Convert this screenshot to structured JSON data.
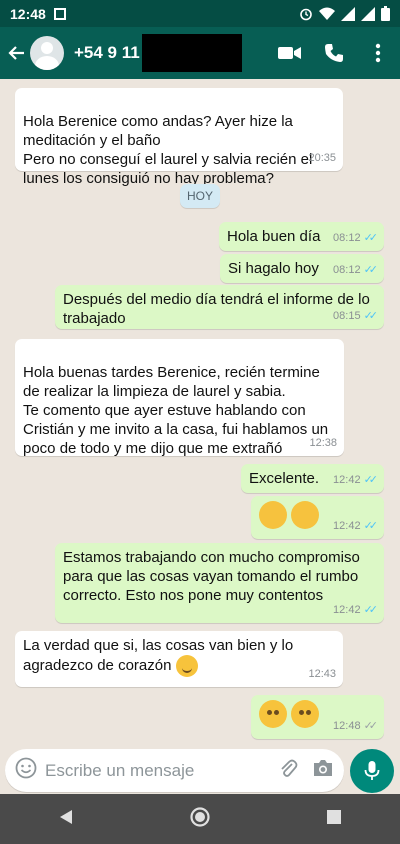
{
  "status_bar": {
    "time": "12:48"
  },
  "header": {
    "contact_name": "+54 9 11"
  },
  "date_chip": "HOY",
  "messages": [
    {
      "dir": "in",
      "text": "Hola Berenice como andas? Ayer hize la meditación y el baño\nPero no conseguí el laurel y salvia recién el lunes los consiguió no hay problema?",
      "time": "20:35"
    },
    {
      "dir": "out",
      "text": "Hola buen día",
      "time": "08:12"
    },
    {
      "dir": "out",
      "text": "Si hagalo hoy",
      "time": "08:12"
    },
    {
      "dir": "out",
      "text": "Después del medio día tendrá el informe de lo trabajado",
      "time": "08:15"
    },
    {
      "dir": "in",
      "text": "Hola buenas tardes Berenice, recién termine de realizar la limpieza de laurel y sabia.\nTe comento que ayer estuve hablando con Cristián y me invito a la casa, fui hablamos un poco de todo y me dijo que me extrañó",
      "time": "12:38"
    },
    {
      "dir": "out",
      "text": "Excelente.",
      "time": "12:42"
    },
    {
      "dir": "out",
      "text": "",
      "time": "12:42"
    },
    {
      "dir": "out",
      "text": "Estamos trabajando con mucho compromiso para que las cosas vayan tomando el rumbo correcto. Esto nos pone muy contentos",
      "time": "12:42"
    },
    {
      "dir": "in",
      "text": "La verdad que si, las cosas van bien y lo agradezco de corazón",
      "time": "12:43"
    },
    {
      "dir": "out",
      "text": "",
      "time": "12:48"
    }
  ],
  "composer": {
    "placeholder": "Escribe un mensaje"
  },
  "icons": [
    "back-arrow-icon",
    "video-call-icon",
    "phone-icon",
    "more-icon",
    "emoji-icon",
    "attach-icon",
    "camera-icon",
    "mic-icon",
    "nav-back-icon",
    "nav-home-icon",
    "nav-recents-icon"
  ],
  "colors": {
    "header": "#075e54",
    "status_bar": "#054d44",
    "outgoing": "#dcf8c6",
    "incoming": "#ffffff",
    "chat_bg": "#ece5dd",
    "accent": "#00897b",
    "read_ticks": "#4fc3f7"
  }
}
